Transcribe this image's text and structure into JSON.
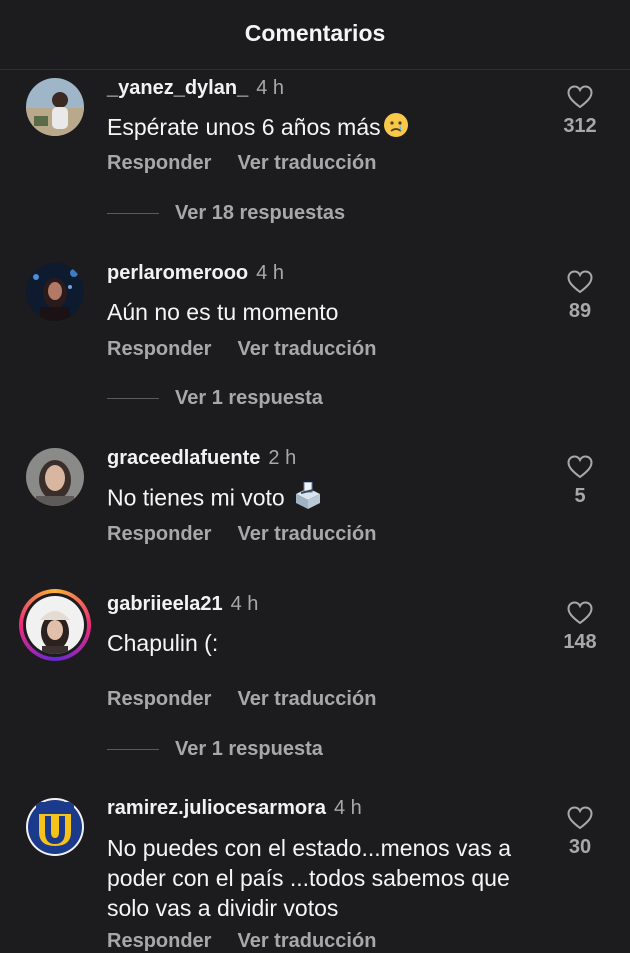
{
  "header": {
    "title": "Comentarios"
  },
  "comments": [
    {
      "username": "_yanez_dylan_",
      "time": "4 h",
      "text": "Espérate unos 6 años más",
      "emoji": "crying-face",
      "likes": "312",
      "reply_label": "Responder",
      "translate_label": "Ver traducción",
      "view_replies": "Ver 18 respuestas"
    },
    {
      "username": "perlaromerooo",
      "time": "4 h",
      "text": "Aún no es tu momento",
      "likes": "89",
      "reply_label": "Responder",
      "translate_label": "Ver traducción",
      "view_replies": "Ver 1 respuesta"
    },
    {
      "username": "graceedlafuente",
      "time": "2 h",
      "text": "No tienes mi voto",
      "emoji": "ballot-box",
      "likes": "5",
      "reply_label": "Responder",
      "translate_label": "Ver traducción"
    },
    {
      "username": "gabriieela21",
      "time": "4 h",
      "text": "Chapulin (:",
      "likes": "148",
      "reply_label": "Responder",
      "translate_label": "Ver traducción",
      "view_replies": "Ver 1 respuesta"
    },
    {
      "username": "ramirez.juliocesarmora",
      "time": "4 h",
      "text": "No puedes con el estado...menos vas a poder con el país ...todos sabemos que solo vas a dividir votos",
      "likes": "30",
      "reply_label": "Responder",
      "translate_label": "Ver traducción"
    }
  ],
  "colors": {
    "background": "#1c1c1e",
    "secondary_text": "#a8a8a8",
    "primary_text": "#f5f5f5"
  },
  "icons": {
    "like": "heart-outline-icon"
  }
}
